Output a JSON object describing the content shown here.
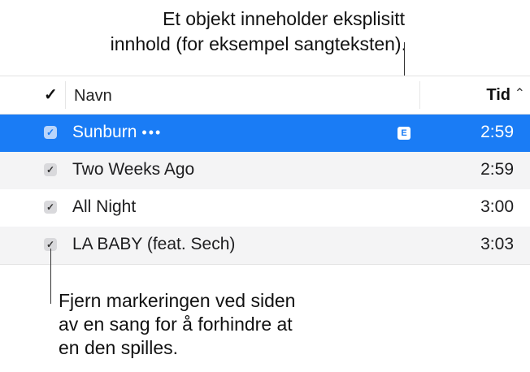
{
  "callouts": {
    "top_line1": "Et objekt inneholder eksplisitt",
    "top_line2": "innhold (for eksempel sangteksten).",
    "bottom_line1": "Fjern markeringen ved siden",
    "bottom_line2": "av en sang for å forhindre at",
    "bottom_line3": "en den spilles."
  },
  "header": {
    "check_symbol": "✓",
    "name_label": "Navn",
    "time_label": "Tid",
    "sort_icon": "^"
  },
  "rows": [
    {
      "title": "Sunburn",
      "more": "•••",
      "explicit_badge": "E",
      "time": "2:59",
      "checked": true,
      "selected": true
    },
    {
      "title": "Two Weeks Ago",
      "time": "2:59",
      "checked": true
    },
    {
      "title": "All Night",
      "time": "3:00",
      "checked": true
    },
    {
      "title": "LA BABY (feat. Sech)",
      "time": "3:03",
      "checked": true
    }
  ],
  "colors": {
    "selection": "#1a7cf5",
    "alt_row": "#f4f4f5"
  }
}
